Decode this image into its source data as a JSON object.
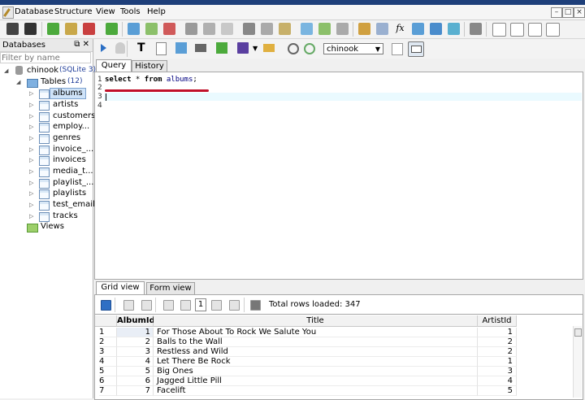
{
  "menu": [
    "Database",
    "Structure",
    "View",
    "Tools",
    "Help"
  ],
  "window_controls": [
    "–",
    "□",
    "×"
  ],
  "databases_panel": {
    "title": "Databases",
    "header_icons": "⧉ ✕",
    "filter_placeholder": "Filter by name",
    "db_name": "chinook",
    "db_type": "(SQLite 3)",
    "tables_label": "Tables",
    "tables_count": "(12)",
    "tables": [
      "albums",
      "artists",
      "customers",
      "employ...",
      "genres",
      "invoice_...",
      "invoices",
      "media_t...",
      "playlist_...",
      "playlists",
      "test_email",
      "tracks"
    ],
    "views_label": "Views"
  },
  "editor": {
    "db_select": "chinook",
    "tabs": [
      "Query",
      "History"
    ],
    "line_numbers": [
      "1",
      "2",
      "3",
      "4"
    ],
    "sql_keyword1": "select",
    "sql_star": " * ",
    "sql_keyword2": "from",
    "sql_table": " albums",
    "sql_end": ";"
  },
  "results": {
    "tabs": [
      "Grid view",
      "Form view"
    ],
    "page_number": "1",
    "total_rows": "Total rows loaded: 347",
    "columns": [
      "AlbumId",
      "Title",
      "ArtistId"
    ],
    "rows": [
      {
        "n": "1",
        "id": "1",
        "title": "For Those About To Rock We Salute You",
        "artist": "1"
      },
      {
        "n": "2",
        "id": "2",
        "title": "Balls to the Wall",
        "artist": "2"
      },
      {
        "n": "3",
        "id": "3",
        "title": "Restless and Wild",
        "artist": "2"
      },
      {
        "n": "4",
        "id": "4",
        "title": "Let There Be Rock",
        "artist": "1"
      },
      {
        "n": "5",
        "id": "5",
        "title": "Big Ones",
        "artist": "3"
      },
      {
        "n": "6",
        "id": "6",
        "title": "Jagged Little Pill",
        "artist": "4"
      },
      {
        "n": "7",
        "id": "7",
        "title": "Facelift",
        "artist": "5"
      }
    ]
  },
  "colors": {
    "accent_red": "#c0112a",
    "selection": "#cfe3f8",
    "keyword": "#000080"
  }
}
